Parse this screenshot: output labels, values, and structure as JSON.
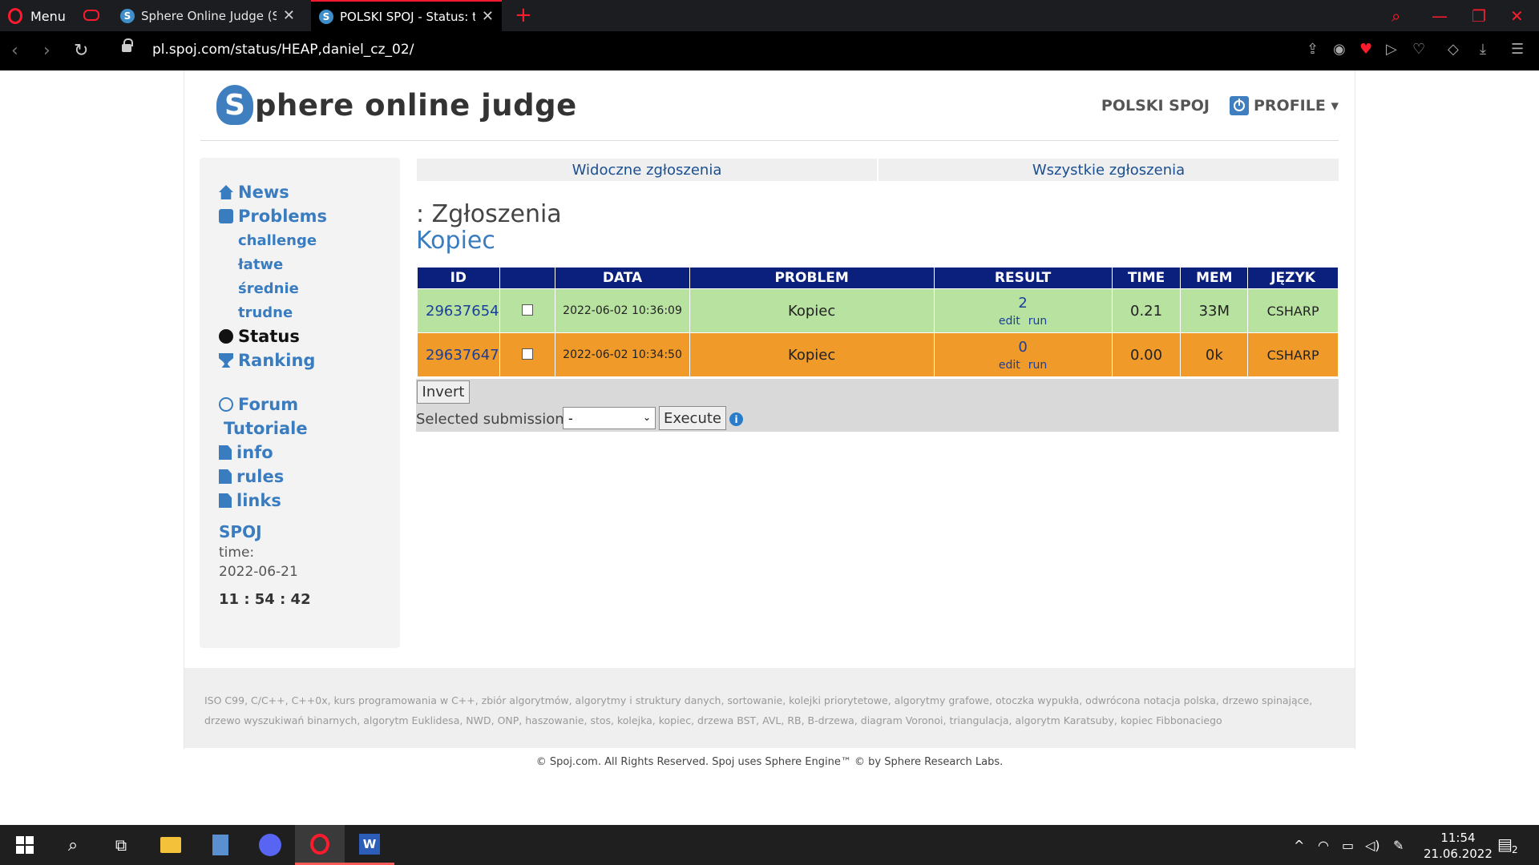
{
  "browser": {
    "menu_label": "Menu",
    "tabs": [
      {
        "title": "Sphere Online Judge (SPOJ)",
        "favicon": "S"
      },
      {
        "title": "POLSKI SPOJ - Status: test y",
        "favicon": "S"
      }
    ],
    "url": "pl.spoj.com/status/HEAP,daniel_cz_02/"
  },
  "site": {
    "logo_letter": "S",
    "logo_text": "phere online judge",
    "nav_polski": "POLSKI SPOJ",
    "nav_profile": "PROFILE ▾"
  },
  "sidebar": {
    "news": "News",
    "problems": "Problems",
    "sub": [
      "challenge",
      "łatwe",
      "średnie",
      "trudne"
    ],
    "status": "Status",
    "ranking": "Ranking",
    "forum": "Forum",
    "tutoriale": "Tutoriale",
    "info": "info",
    "rules": "rules",
    "links": "links",
    "spoj": "SPOJ",
    "time_label": "time:",
    "date": "2022-06-21",
    "clock": "11 : 54 : 42"
  },
  "subtabs": [
    "Widoczne zgłoszenia",
    "Wszystkie zgłoszenia"
  ],
  "heading": ": Zgłoszenia",
  "problem_name": "Kopiec",
  "table": {
    "headers": [
      "ID",
      "",
      "DATA",
      "PROBLEM",
      "RESULT",
      "TIME",
      "MEM",
      "JĘZYK"
    ],
    "rows": [
      {
        "id": "29637654",
        "date": "2022-06-02 10:36:09",
        "problem": "Kopiec",
        "result": "2",
        "edit": "edit",
        "run": "run",
        "time": "0.21",
        "mem": "33M",
        "lang": "CSHARP",
        "status": "accepted"
      },
      {
        "id": "29637647",
        "date": "2022-06-02 10:34:50",
        "problem": "Kopiec",
        "result": "0",
        "edit": "edit",
        "run": "run",
        "time": "0.00",
        "mem": "0k",
        "lang": "CSHARP",
        "status": "wrong"
      }
    ]
  },
  "controls": {
    "invert": "Invert",
    "selected_label": "Selected submissions:",
    "select_value": "-",
    "execute": "Execute",
    "info_glyph": "i"
  },
  "footer": {
    "keywords": "ISO C99, C/C++, C++0x, kurs programowania w C++, zbiór algorytmów, algorytmy i struktury danych, sortowanie, kolejki priorytetowe, algorytmy grafowe, otoczka wypukła, odwrócona notacja polska, drzewo spinające, drzewo wyszukiwań binarnych, algorytm Euklidesa, NWD, ONP, haszowanie, stos, kolejka, kopiec, drzewa BST, AVL, RB, B-drzewa, diagram Voronoi, triangulacja, algorytm Karatsuby, kopiec Fibbonaciego",
    "copyright": "© Spoj.com. All Rights Reserved. Spoj uses Sphere Engine™ © by Sphere Research Labs."
  },
  "taskbar": {
    "time": "11:54",
    "date": "21.06.2022",
    "notifications": "2"
  },
  "colors": {
    "accepted_row": "#b8e2a0",
    "wrong_row": "#f09a2a",
    "header_bg": "#0b1f7d",
    "link": "#3a7cc0",
    "opera_red": "#ff1b2d"
  }
}
